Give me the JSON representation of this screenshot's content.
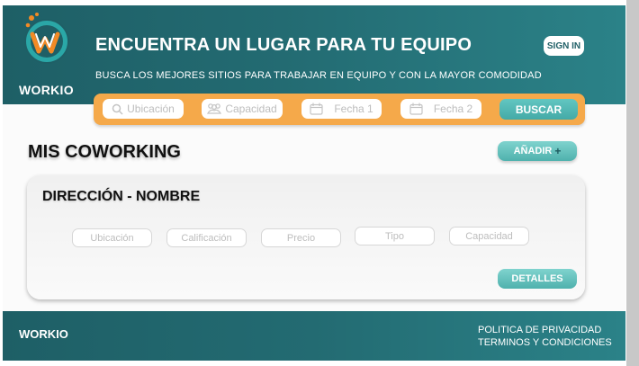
{
  "header": {
    "brand": "WORKIO",
    "title": "ENCUENTRA UN LUGAR PARA TU EQUIPO",
    "subtitle": "BUSCA LOS MEJORES SITIOS PARA TRABAJAR EN EQUIPO Y CON LA MAYOR COMODIDAD",
    "signin_label": "SIGN IN"
  },
  "search": {
    "fields": [
      {
        "label": "Ubicación",
        "icon": "search-icon"
      },
      {
        "label": "Capacidad",
        "icon": "group-icon"
      },
      {
        "label": "Fecha 1",
        "icon": "calendar-icon"
      },
      {
        "label": "Fecha 2",
        "icon": "calendar-icon"
      }
    ],
    "button_label": "BUSCAR"
  },
  "main": {
    "title": "MIS COWORKING",
    "add_label": "AÑADIR",
    "add_icon": "+"
  },
  "card": {
    "title": "DIRECCIÓN - NOMBRE",
    "chips": [
      "Ubicación",
      "Calificación",
      "Precio",
      "Tipo",
      "Capacidad"
    ],
    "details_label": "DETALLES"
  },
  "footer": {
    "brand": "WORKIO",
    "privacy": "POLITICA DE PRIVACIDAD",
    "terms": "TERMINOS Y CONDICIONES"
  },
  "colors": {
    "header_teal": "#236b72",
    "accent_orange": "#f5a94a",
    "button_teal": "#4fb1ad"
  }
}
